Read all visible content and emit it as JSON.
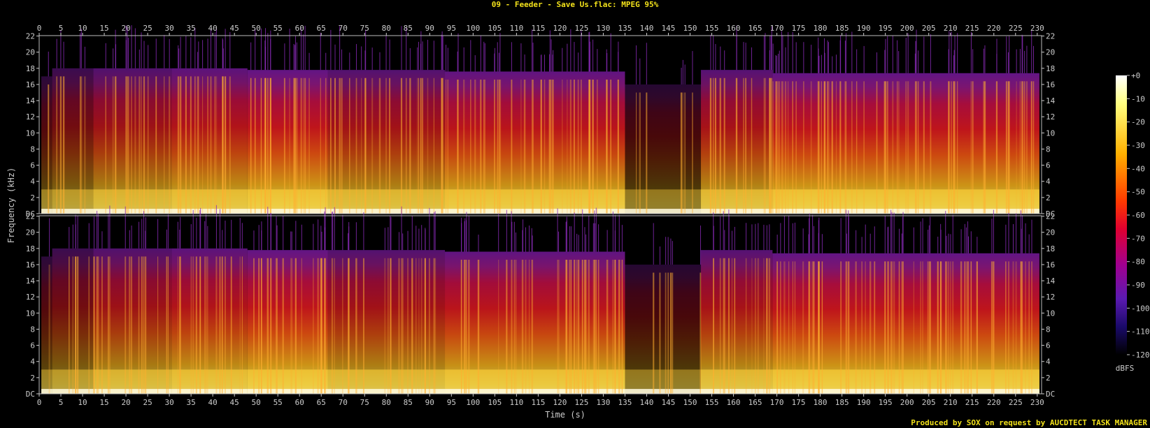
{
  "chart_data": {
    "type": "heatmap",
    "title": "09 - Feeder - Save Us.flac: MPEG 95%",
    "xlabel": "Time (s)",
    "ylabel": "Frequency (kHz)",
    "xlim": [
      0,
      231
    ],
    "ylim": [
      0,
      22.05
    ],
    "x_ticks": [
      0,
      5,
      10,
      15,
      20,
      25,
      30,
      35,
      40,
      45,
      50,
      55,
      60,
      65,
      70,
      75,
      80,
      85,
      90,
      95,
      100,
      105,
      110,
      115,
      120,
      125,
      130,
      135,
      140,
      145,
      150,
      155,
      160,
      165,
      170,
      175,
      180,
      185,
      190,
      195,
      200,
      205,
      210,
      215,
      220,
      225,
      230
    ],
    "y_ticks": [
      {
        "value": 0,
        "label": "DC"
      },
      {
        "value": 2,
        "label": "2"
      },
      {
        "value": 4,
        "label": "4"
      },
      {
        "value": 6,
        "label": "6"
      },
      {
        "value": 8,
        "label": "8"
      },
      {
        "value": 10,
        "label": "10"
      },
      {
        "value": 12,
        "label": "12"
      },
      {
        "value": 14,
        "label": "14"
      },
      {
        "value": 16,
        "label": "16"
      },
      {
        "value": 18,
        "label": "18"
      },
      {
        "value": 20,
        "label": "20"
      },
      {
        "value": 22,
        "label": "22"
      }
    ],
    "channels": [
      "top",
      "bottom"
    ],
    "colorbar": {
      "label": "dBFS",
      "range": [
        -120,
        0
      ],
      "ticks": [
        "+0",
        "-10",
        "-20",
        "-30",
        "-40",
        "-50",
        "-60",
        "-70",
        "-80",
        "-90",
        "-100",
        "-110",
        "-120"
      ]
    },
    "segments": [
      {
        "t0": 0.5,
        "t1": 3,
        "cutoff": 17,
        "intensity": 0.35
      },
      {
        "t0": 3,
        "t1": 12.5,
        "cutoff": 18,
        "intensity": 0.48
      },
      {
        "t0": 12.5,
        "t1": 30.5,
        "cutoff": 18,
        "intensity": 0.66
      },
      {
        "t0": 30.5,
        "t1": 48,
        "cutoff": 18,
        "intensity": 0.74
      },
      {
        "t0": 48,
        "t1": 66.5,
        "cutoff": 17.8,
        "intensity": 0.8
      },
      {
        "t0": 66.5,
        "t1": 93.5,
        "cutoff": 17.8,
        "intensity": 0.68
      },
      {
        "t0": 93.5,
        "t1": 135,
        "cutoff": 17.6,
        "intensity": 0.78
      },
      {
        "t0": 135,
        "t1": 152.5,
        "cutoff": 16,
        "intensity": 0.3
      },
      {
        "t0": 152.5,
        "t1": 169,
        "cutoff": 17.8,
        "intensity": 0.7
      },
      {
        "t0": 169,
        "t1": 230.5,
        "cutoff": 17.4,
        "intensity": 0.8
      }
    ],
    "credit": "Produced by SOX on request by AUCDTECT TASK MANAGER",
    "colors": {
      "title": "#f2e11a",
      "axis": "#cccccc",
      "background": "#000000",
      "credit": "#f2e11a"
    }
  }
}
